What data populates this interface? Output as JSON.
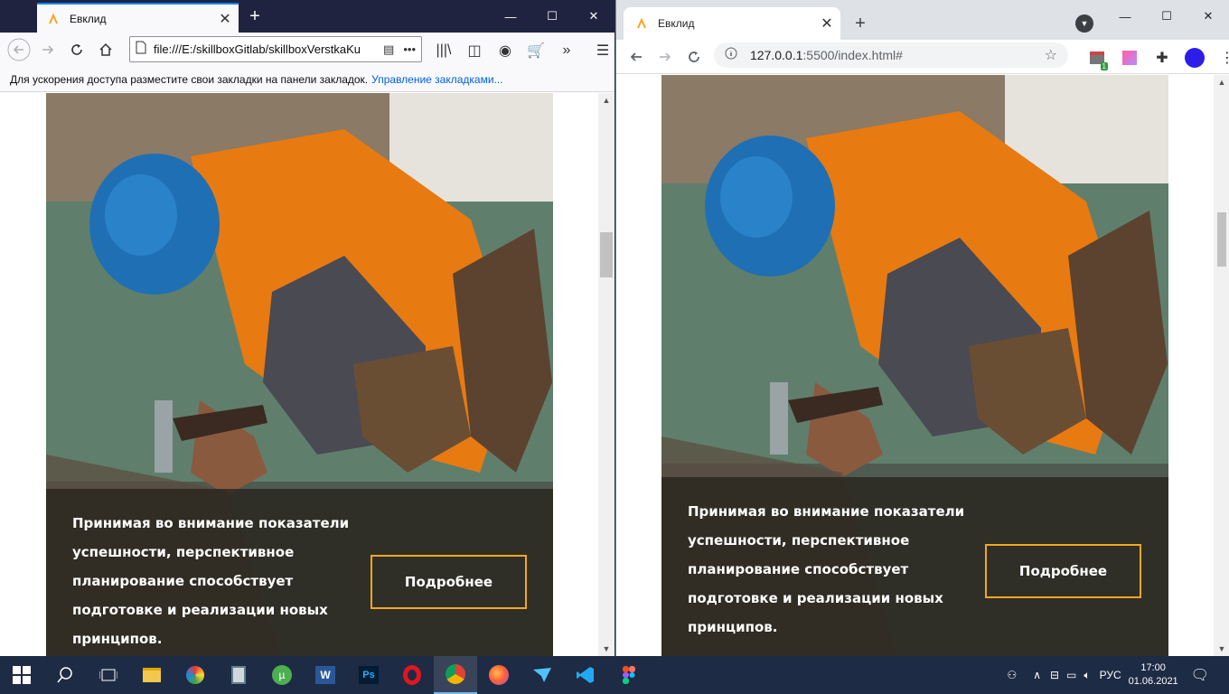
{
  "firefox": {
    "tab_title": "Евклид",
    "url": "file:///E:/skillboxGitlab/skillboxVerstkaKu",
    "bookmarks_hint": "Для ускорения доступа разместите свои закладки на панели закладок.",
    "bookmarks_link": "Управление закладками..."
  },
  "chrome": {
    "tab_title": "Евклид",
    "url_host": "127.0.0.1",
    "url_rest": ":5500/index.html#",
    "extension_badge": "1"
  },
  "page": {
    "card_text": "Принимая во внимание показатели успешности, перспективное планирование способствует подготовке и реализации новых принципов.",
    "button_label": "Подробнее",
    "accent_color": "#f5a623"
  },
  "taskbar": {
    "apps": [
      "windows-start",
      "search",
      "task-view",
      "file-explorer",
      "paint",
      "calculator",
      "utorrent",
      "word",
      "photoshop",
      "opera",
      "chrome",
      "firefox",
      "telegram-like",
      "vscode",
      "figma"
    ],
    "language": "РУС",
    "time": "17:00",
    "date": "01.06.2021"
  }
}
